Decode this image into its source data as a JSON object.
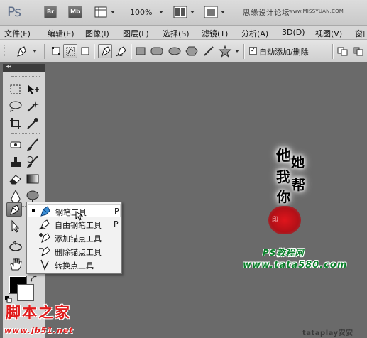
{
  "app": {
    "logo": "Ps",
    "bridge_label": "Br",
    "minibridge_label": "Mb",
    "zoom": "100%",
    "site_name": "思缘设计论坛",
    "site_url": "www.MISSYUAN.COM"
  },
  "menu": [
    "文件(F)",
    "编辑(E)",
    "图像(I)",
    "图层(L)",
    "选择(S)",
    "滤镜(T)",
    "分析(A)",
    "3D(D)",
    "视图(V)",
    "窗口"
  ],
  "options_bar": {
    "auto_add_delete_label": "自动添加/删除",
    "auto_add_delete_checked": true,
    "check_mark": "✓"
  },
  "tools_panel": {
    "collapse_glyph": "◂◂"
  },
  "flyout": {
    "items": [
      {
        "label": "钢笔工具",
        "key": "P",
        "selected": true
      },
      {
        "label": "自由钢笔工具",
        "key": "P",
        "selected": false
      },
      {
        "label": "添加锚点工具",
        "key": "",
        "selected": false
      },
      {
        "label": "删除锚点工具",
        "key": "",
        "selected": false
      },
      {
        "label": "转换点工具",
        "key": "",
        "selected": false
      }
    ]
  },
  "canvas": {
    "calligraphy": [
      "他",
      "她",
      "我",
      "帮",
      "你"
    ],
    "seal_text": "印",
    "watermark_line1": "PS教程网",
    "watermark_line2": "www.tata580.com",
    "jb51_cn": "脚本之家",
    "jb51_url": "www.jb51.net",
    "corner_mark": "tataplay安安"
  },
  "colors": {
    "workspace": "#6a6a6a",
    "seal_red": "#c8141a",
    "watermark_green": "#0a7f2a",
    "watermark_red": "#e01b1b"
  }
}
